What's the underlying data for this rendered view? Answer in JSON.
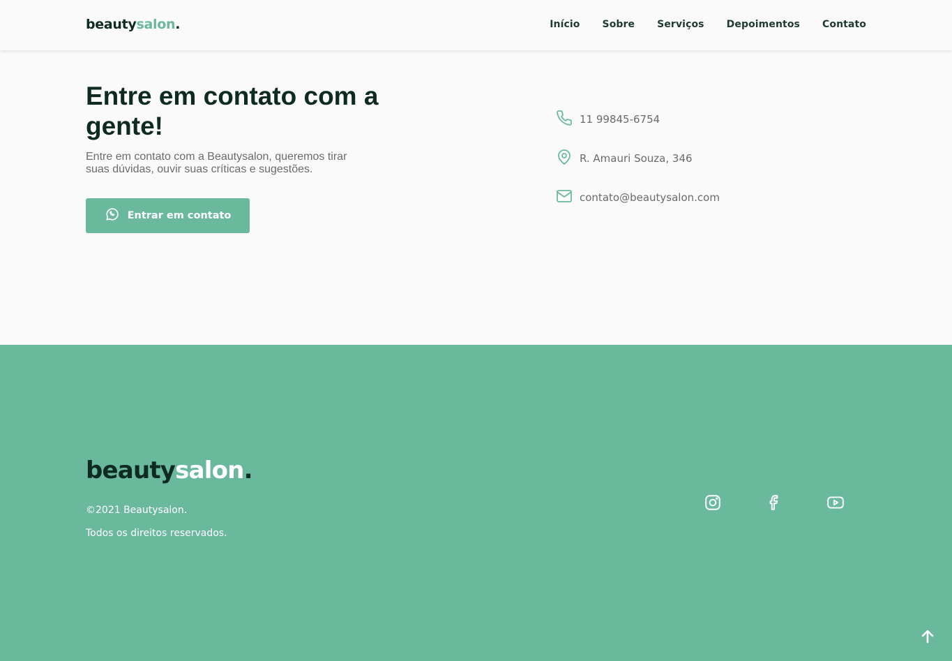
{
  "header": {
    "logo_main": "beauty",
    "logo_accent": "salon",
    "logo_dot": ".",
    "nav": [
      "Início",
      "Sobre",
      "Serviços",
      "Depoimentos",
      "Contato"
    ]
  },
  "contact": {
    "title": "Entre em contato com a gente!",
    "description": "Entre em contato com a Beautysalon, queremos tirar suas dúvidas, ouvir suas críticas e sugestões.",
    "cta_label": "Entrar em contato",
    "phone": "11 99845-6754",
    "address": "R. Amauri Souza, 346",
    "email": "contato@beautysalon.com"
  },
  "footer": {
    "logo_main": "beauty",
    "logo_accent": "salon",
    "logo_dot": ".",
    "copyright": "©2021 Beautysalon.",
    "rights": "Todos os direitos reservados."
  },
  "icons": {
    "cta": "whatsapp-icon",
    "phone": "phone-icon",
    "address": "map-pin-icon",
    "email": "mail-icon",
    "social": [
      "instagram-icon",
      "facebook-icon",
      "youtube-icon"
    ],
    "back_to_top": "arrow-up-icon"
  },
  "colors": {
    "accent": "#6ab99c",
    "dark": "#0d2b21",
    "text_muted": "#6b6b6b",
    "background": "#fafafa"
  }
}
